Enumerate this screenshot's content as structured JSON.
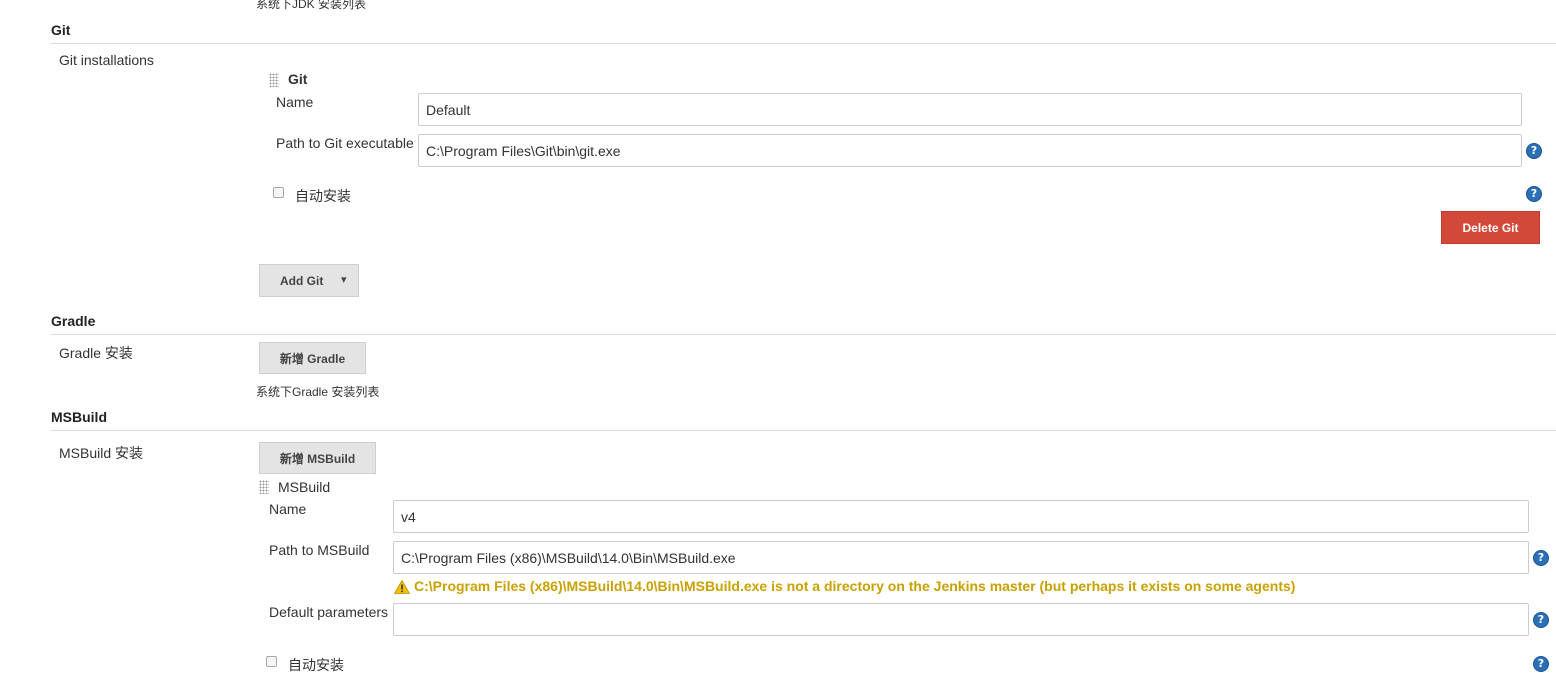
{
  "jdk": {
    "description_partial": "系统下JDK 安装列表"
  },
  "git": {
    "section_title": "Git",
    "installations_label": "Git installations",
    "block_title": "Git",
    "name_label": "Name",
    "name_value": "Default",
    "path_label": "Path to Git executable",
    "path_value": "C:\\Program Files\\Git\\bin\\git.exe",
    "auto_install_label": "自动安装",
    "delete_button": "Delete Git",
    "add_button": "Add Git",
    "add_dropdown_glyph": "▾"
  },
  "gradle": {
    "section_title": "Gradle",
    "install_label": "Gradle 安装",
    "add_button": "新增 Gradle",
    "description": "系统下Gradle 安装列表"
  },
  "msbuild": {
    "section_title": "MSBuild",
    "install_label": "MSBuild 安装",
    "add_button": "新增 MSBuild",
    "block_title": "MSBuild",
    "name_label": "Name",
    "name_value": "v4",
    "path_label": "Path to MSBuild",
    "path_value": "C:\\Program Files (x86)\\MSBuild\\14.0\\Bin\\MSBuild.exe",
    "warning": "C:\\Program Files (x86)\\MSBuild\\14.0\\Bin\\MSBuild.exe is not a directory on the Jenkins master (but perhaps it exists on some agents)",
    "params_label": "Default parameters",
    "params_value": "",
    "auto_install_label": "自动安装"
  },
  "help_glyph": "?",
  "colors": {
    "danger": "#d24939",
    "help": "#2b6fb6",
    "warning": "#c9a100",
    "rule": "#dddddd"
  }
}
